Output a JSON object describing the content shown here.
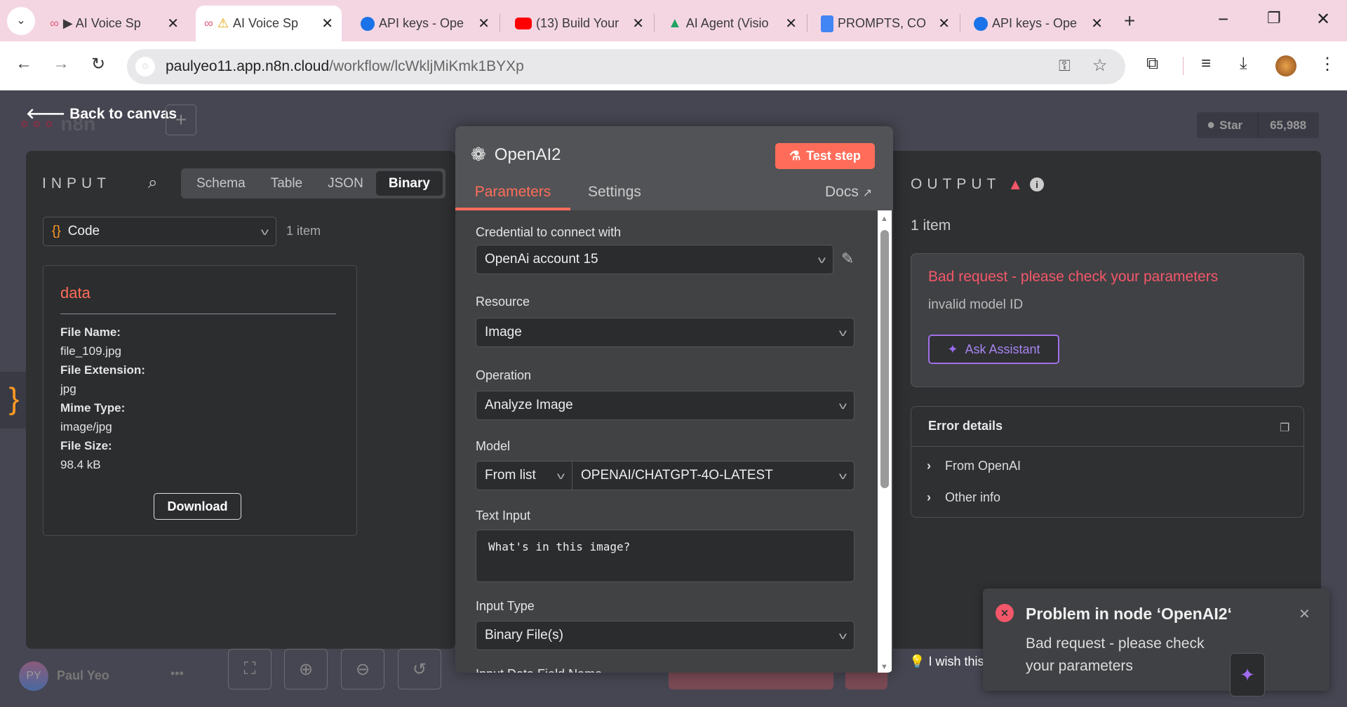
{
  "browser": {
    "tabs": [
      {
        "title": "▶ AI Voice Sp",
        "icon": "n8n-icon",
        "active": false
      },
      {
        "title": "AI Voice Sp",
        "icon": "warning-icon",
        "active": true
      },
      {
        "title": "API keys - Ope",
        "icon": "openai-icon",
        "active": false
      },
      {
        "title": "(13) Build Your",
        "icon": "youtube-icon",
        "active": false
      },
      {
        "title": "AI Agent (Visio",
        "icon": "google-drive-icon",
        "active": false
      },
      {
        "title": "PROMPTS, CO",
        "icon": "google-docs-icon",
        "active": false
      },
      {
        "title": "API keys - Ope",
        "icon": "openai-icon",
        "active": false
      }
    ],
    "url_host": "paulyeo11.app.n8n.cloud",
    "url_path": "/workflow/lcWkljMiKmk1BYXp"
  },
  "canvas": {
    "back_label": "Back to canvas",
    "logo_text": "n8n",
    "star_label": "Star",
    "star_count": "65,988",
    "user_initials": "PY",
    "user_name": "Paul Yeo",
    "wish_text": "I wish this"
  },
  "input": {
    "title": "INPUT",
    "views": [
      "Schema",
      "Table",
      "JSON",
      "Binary"
    ],
    "active_view": "Binary",
    "source_node": "Code",
    "item_count": "1 item",
    "binary": {
      "key": "data",
      "fields": [
        {
          "label": "File Name:",
          "value": "file_109.jpg"
        },
        {
          "label": "File Extension:",
          "value": "jpg"
        },
        {
          "label": "Mime Type:",
          "value": "image/jpg"
        },
        {
          "label": "File Size:",
          "value": "98.4 kB"
        }
      ],
      "download_label": "Download"
    }
  },
  "node": {
    "name": "OpenAI2",
    "test_step_label": "Test step",
    "tabs": [
      "Parameters",
      "Settings"
    ],
    "active_tab": "Parameters",
    "docs_label": "Docs",
    "params": {
      "credential_label": "Credential to connect with",
      "credential_value": "OpenAi account 15",
      "resource_label": "Resource",
      "resource_value": "Image",
      "operation_label": "Operation",
      "operation_value": "Analyze Image",
      "model_label": "Model",
      "model_mode": "From list",
      "model_value": "OPENAI/CHATGPT-4O-LATEST",
      "text_input_label": "Text Input",
      "text_input_value": "What's in this image?",
      "input_type_label": "Input Type",
      "input_type_value": "Binary File(s)",
      "next_label": "Input Data Field Name"
    }
  },
  "output": {
    "title": "OUTPUT",
    "item_count": "1 item",
    "error_title": "Bad request - please check your parameters",
    "error_message": "invalid model ID",
    "ask_assistant_label": "Ask Assistant",
    "error_details_label": "Error details",
    "details": [
      "From OpenAI",
      "Other info"
    ]
  },
  "toast": {
    "title": "Problem in node ‘OpenAI2‘",
    "message": "Bad request - please check your parameters"
  },
  "colors": {
    "accent": "#ff6d5a",
    "error": "#f4576a",
    "assistant": "#8b6cf6"
  }
}
